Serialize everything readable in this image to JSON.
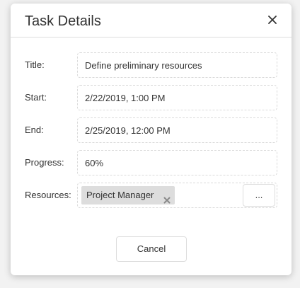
{
  "dialog": {
    "title": "Task Details",
    "close_icon": "close-icon"
  },
  "form": {
    "title_label": "Title:",
    "title_value": "Define preliminary resources",
    "start_label": "Start:",
    "start_value": "2/22/2019, 1:00 PM",
    "end_label": "End:",
    "end_value": "2/25/2019, 12:00 PM",
    "progress_label": "Progress:",
    "progress_value": "60%",
    "resources_label": "Resources:",
    "resources": [
      {
        "label": "Project Manager",
        "remove_icon": "remove-tag-icon"
      }
    ],
    "resources_button_label": "..."
  },
  "footer": {
    "cancel_label": "Cancel"
  }
}
